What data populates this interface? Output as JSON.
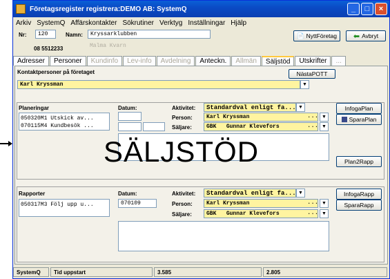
{
  "window": {
    "title": "Företagsregister registrera:DEMO AB: SystemQ"
  },
  "menu": [
    "Arkiv",
    "SystemQ",
    "Affärskontakter",
    "Sökrutiner",
    "Verktyg",
    "Inställningar",
    "Hjälp"
  ],
  "header": {
    "nr_label": "Nr:",
    "nr_value": "120",
    "namn_label": "Namn:",
    "namn_value": "Kryssarklubben",
    "orgnr": "08 5512233",
    "alt_name": "Malma Kvarn",
    "nytt_foretag": "NyttFöretag",
    "avbryt": "Avbryt"
  },
  "tabs": [
    {
      "label": "Adresser",
      "state": "normal"
    },
    {
      "label": "Personer",
      "state": "normal"
    },
    {
      "label": "Kundinfo",
      "state": "disabled"
    },
    {
      "label": "Lev-info",
      "state": "disabled"
    },
    {
      "label": "Avdelning",
      "state": "disabled"
    },
    {
      "label": "Anteckn.",
      "state": "normal"
    },
    {
      "label": "Allmän",
      "state": "disabled"
    },
    {
      "label": "Säljstöd",
      "state": "active"
    },
    {
      "label": "Utskrifter",
      "state": "normal"
    },
    {
      "label": "...",
      "state": "disabled"
    }
  ],
  "contacts": {
    "label": "Kontaktpersoner på företaget",
    "value": "Karl Kryssman",
    "nasta_pott": "NästaPOTT"
  },
  "planeringar": {
    "title": "Planeringar",
    "datum_label": "Datum:",
    "items": [
      "050320M1  Utskick av...",
      "070115M4  Kundbesök ..."
    ],
    "aktivitet_label": "Aktivitet:",
    "aktivitet_value": "Standardval enligt fa...",
    "person_label": "Person:",
    "person_value": "Karl Kryssman",
    "saljare_label": "Säljare:",
    "saljare_code": "GBK",
    "saljare_name": "Gunnar Klevefors",
    "infoga": "InfogaPlan",
    "spara": "SparaPlan",
    "rapp": "Plan2Rapp"
  },
  "rapporter": {
    "title": "Rapporter",
    "datum_label": "Datum:",
    "items": [
      "050317M3  Följ upp u..."
    ],
    "datum_value": "070109",
    "aktivitet_label": "Aktivitet:",
    "aktivitet_value": "Standardval enligt fa...",
    "person_label": "Person:",
    "person_value": "Karl Kryssman",
    "saljare_label": "Säljare:",
    "saljare_code": "GBK",
    "saljare_name": "Gunnar Klevefors",
    "infoga": "InfogaRapp",
    "spara": "SparaRapp"
  },
  "overlay_text": "SÄLJSTÖD",
  "status": {
    "app": "SystemQ",
    "label": "Tid uppstart",
    "v1": "3.585",
    "v2": "2.805"
  },
  "colors": {
    "titlebar": "#0a4bc5",
    "yellow_field": "#fff4a0",
    "window_bg": "#ece9d8"
  }
}
